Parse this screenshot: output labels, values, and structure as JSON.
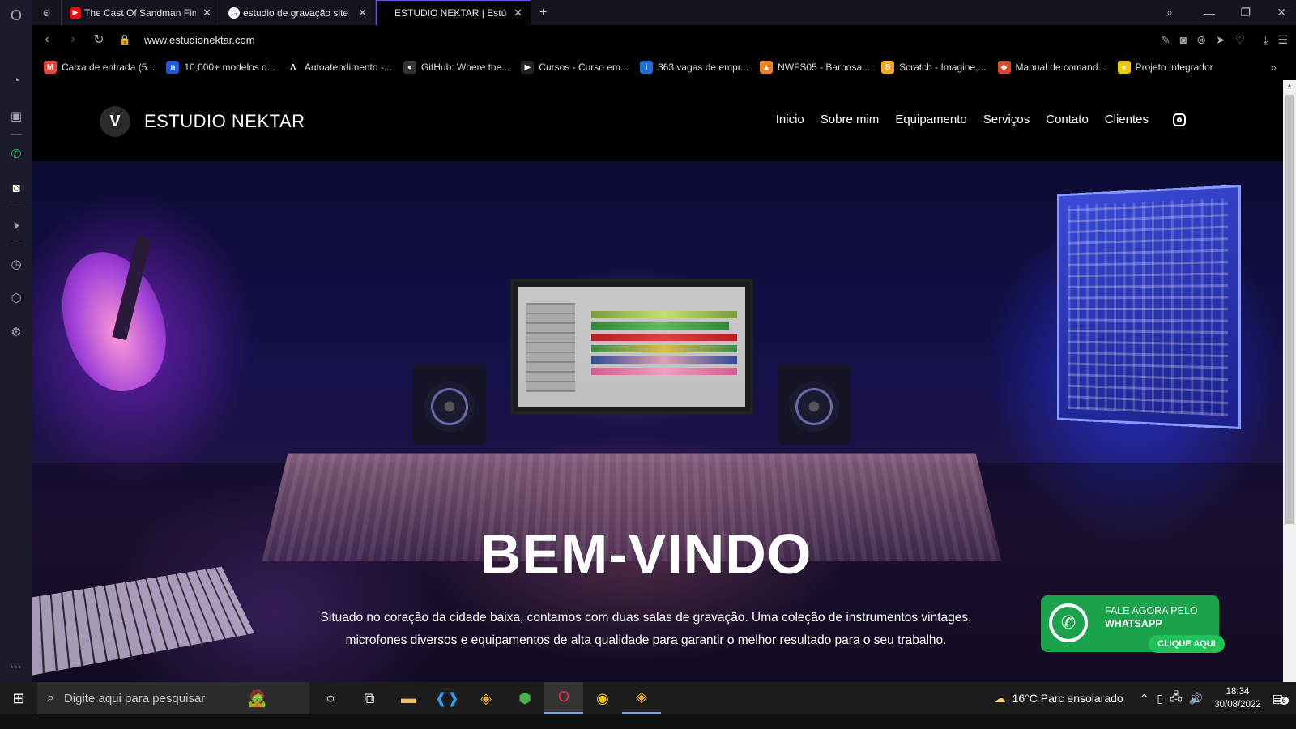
{
  "browser": {
    "tabs": [
      {
        "label": "The Cast Of Sandman Findi",
        "favicon": "youtube-icon",
        "color": "#ff0000"
      },
      {
        "label": "estudio de gravação site - P",
        "favicon": "google-icon",
        "color": "#4285f4"
      },
      {
        "label": "ESTUDIO NEKTAR | Estúdio",
        "favicon": "",
        "color": "#000000",
        "active": true
      }
    ],
    "url": "www.estudionektar.com",
    "bookmarks": [
      {
        "label": "Caixa de entrada (5...",
        "icon": "gmail-icon",
        "color": "#ea4335",
        "glyph": "M"
      },
      {
        "label": "10,000+ modelos d...",
        "icon": "n-icon",
        "color": "#1e5bd8",
        "glyph": "n"
      },
      {
        "label": "Autoatendimento -...",
        "icon": "a-icon",
        "color": "#000000",
        "glyph": "Λ"
      },
      {
        "label": "GitHub: Where the...",
        "icon": "github-icon",
        "color": "#333333",
        "glyph": "●"
      },
      {
        "label": "Cursos - Curso em...",
        "icon": "play-icon",
        "color": "#222222",
        "glyph": "▶"
      },
      {
        "label": "363 vagas de empr...",
        "icon": "info-icon",
        "color": "#1d6fd6",
        "glyph": "i"
      },
      {
        "label": "NWFS05 - Barbosa...",
        "icon": "moodle-icon",
        "color": "#f08020",
        "glyph": "▲"
      },
      {
        "label": "Scratch - Imagine,...",
        "icon": "scratch-icon",
        "color": "#f5a623",
        "glyph": "S"
      },
      {
        "label": "Manual de comand...",
        "icon": "git-icon",
        "color": "#e0452d",
        "glyph": "◆"
      },
      {
        "label": "Projeto Integrador",
        "icon": "chrome-icon",
        "color": "#f0c800",
        "glyph": "●"
      }
    ]
  },
  "site": {
    "brand": "ESTUDIO NEKTAR",
    "logo_letter": "V",
    "nav": [
      "Inicio",
      "Sobre mim",
      "Equipamento",
      "Serviços",
      "Contato",
      "Clientes"
    ],
    "hero_title": "BEM-VINDO",
    "hero_text": "Situado no coração da cidade baixa, contamos com duas salas de gravação. Uma coleção de instrumentos vintages, microfones diversos e equipamentos de alta qualidade para garantir o melhor resultado para o seu trabalho.",
    "whatsapp": {
      "line1": "FALE AGORA PELO",
      "line2": "WHATSAPP",
      "button": "CLIQUE AQUI"
    }
  },
  "taskbar": {
    "search_placeholder": "Digite aqui para pesquisar",
    "weather": "16°C  Parc ensolarado",
    "time": "18:34",
    "date": "30/08/2022",
    "notifications": "6"
  }
}
